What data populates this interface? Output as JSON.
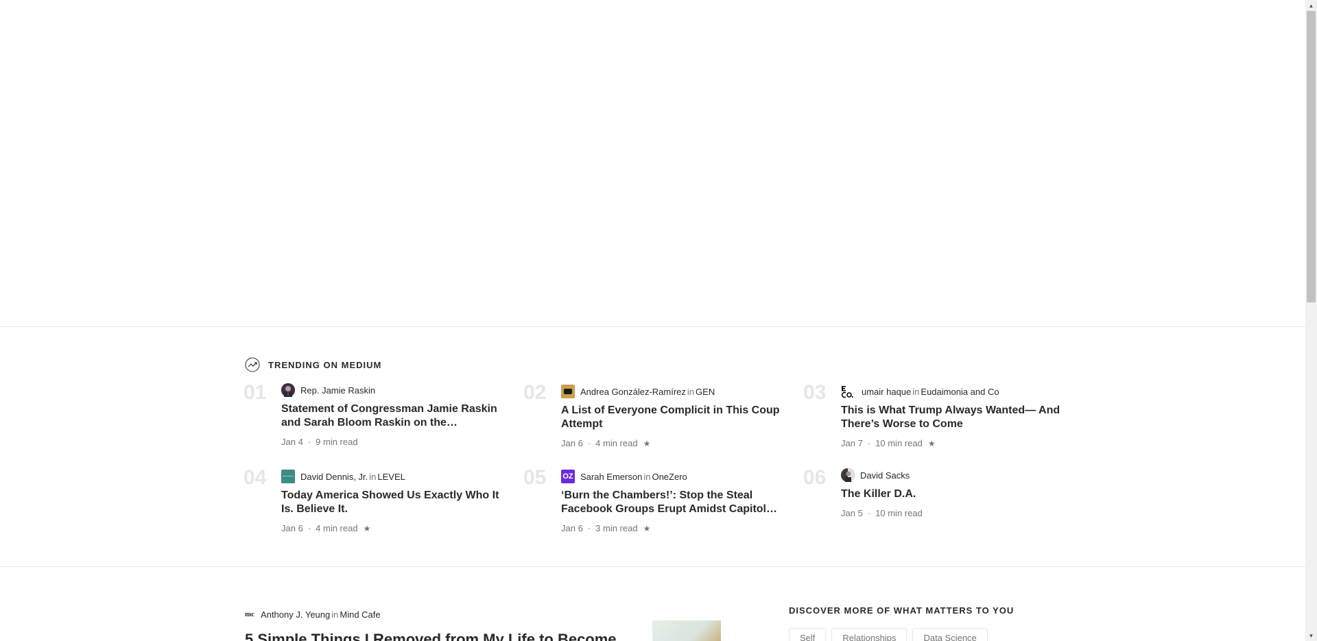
{
  "trending": {
    "title": "TRENDING ON MEDIUM",
    "items": [
      {
        "number": "01",
        "author": "Rep. Jamie Raskin",
        "in_word": "",
        "publication": "",
        "title": "Statement of Congressman Jamie Raskin and Sarah Bloom Raskin on the…",
        "date": "Jan 4",
        "read_time": "9 min read",
        "starred": false,
        "avatar_color": "#5a4a6a"
      },
      {
        "number": "02",
        "author": "Andrea González-Ramírez",
        "in_word": "in",
        "publication": "GEN",
        "title": "A List of Everyone Complicit in This Coup Attempt",
        "date": "Jan 6",
        "read_time": "4 min read",
        "starred": true,
        "avatar_color": "#c9a04a",
        "avatar_text": "GEN"
      },
      {
        "number": "03",
        "author": "umair haque",
        "in_word": "in",
        "publication": "Eudaimonia and Co",
        "title": "This is What Trump Always Wanted— And There’s Worse to Come",
        "date": "Jan 7",
        "read_time": "10 min read",
        "starred": true,
        "avatar_color": "#ffffff",
        "avatar_text": "E CO."
      },
      {
        "number": "04",
        "author": "David Dennis, Jr.",
        "in_word": "in",
        "publication": "LEVEL",
        "title": "Today America Showed Us Exactly Who It Is. Believe It.",
        "date": "Jan 6",
        "read_time": "4 min read",
        "starred": true,
        "avatar_color": "#3d8a86",
        "avatar_text": "LEVEL"
      },
      {
        "number": "05",
        "author": "Sarah Emerson",
        "in_word": "in",
        "publication": "OneZero",
        "title": "‘Burn the Chambers!’: Stop the Steal Facebook Groups Erupt Amidst Capitol…",
        "date": "Jan 6",
        "read_time": "3 min read",
        "starred": true,
        "avatar_color": "#6b2bd9",
        "avatar_text": "OZ"
      },
      {
        "number": "06",
        "author": "David Sacks",
        "in_word": "",
        "publication": "",
        "title": "The Killer D.A.",
        "date": "Jan 5",
        "read_time": "10 min read",
        "starred": false,
        "avatar_color": "#3a3a3a"
      }
    ]
  },
  "feed": {
    "author": "Anthony J. Yeung",
    "in_word": "in",
    "publication": "Mind Cafe",
    "pub_logo": "mc",
    "title": "5 Simple Things I Removed from My Life to Become"
  },
  "discover": {
    "title": "DISCOVER MORE OF WHAT MATTERS TO YOU",
    "tags": [
      "Self",
      "Relationships",
      "Data Science"
    ]
  },
  "icons": {
    "trending": "trending-icon",
    "star": "★",
    "meta_dot": "·"
  }
}
